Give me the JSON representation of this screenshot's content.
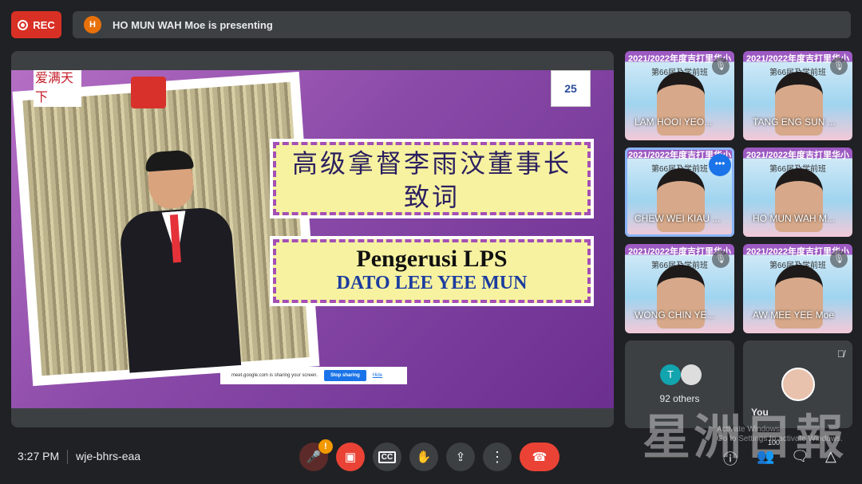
{
  "rec": {
    "label": "REC"
  },
  "banner": {
    "initial": "H",
    "text": "HO MUN WAH Moe is presenting",
    "avatar_color": "#e8710a"
  },
  "slide": {
    "logo_left": "爱满天下",
    "logo_right": "25",
    "title_zh_1": "高级拿督李雨汶董事长",
    "title_zh_2": "致词",
    "role": "Pengerusi LPS",
    "name": "DATO LEE YEE MUN"
  },
  "share_bar": {
    "text": "meet.google.com is sharing your screen.",
    "stop": "Stop sharing",
    "hide": "Hide"
  },
  "participants": [
    {
      "name": "LAM HOOI YEO...",
      "muted": true,
      "bg_title": "2021/2022年度吉打里华小",
      "bg_sub": "第66届及学前班"
    },
    {
      "name": "TANG ENG SUN ...",
      "muted": true,
      "bg_title": "2021/2022年度吉打里华小",
      "bg_sub": "第66届及学前班"
    },
    {
      "name": "CHEW WEI KIAU ...",
      "muted": false,
      "active": true,
      "bg_title": "2021/2022年度吉打里华小",
      "bg_sub": "第66届及学前班"
    },
    {
      "name": "HO MUN WAH M...",
      "muted": false,
      "bg_title": "2021/2022年度吉打里华小",
      "bg_sub": "第66届及学前班"
    },
    {
      "name": "WONG CHIN YE...",
      "muted": true,
      "bg_title": "2021/2022年度吉打里华小",
      "bg_sub": "第66届及学前班"
    },
    {
      "name": "AW MEE YEE Moe",
      "muted": true,
      "bg_title": "2021/2022年度吉打里华小",
      "bg_sub": "第66届及学前班"
    }
  ],
  "others": {
    "initial": "T",
    "label": "92 others"
  },
  "self": {
    "label": "You",
    "muted": true
  },
  "bottom": {
    "time": "3:27 PM",
    "meeting_code": "wje-bhrs-eaa",
    "mic_alert": "!",
    "participant_count": "100"
  },
  "watermark": {
    "logo": "星洲日报",
    "activate_1": "Activate Windows",
    "activate_2": "Go to Settings to activate Windows."
  }
}
